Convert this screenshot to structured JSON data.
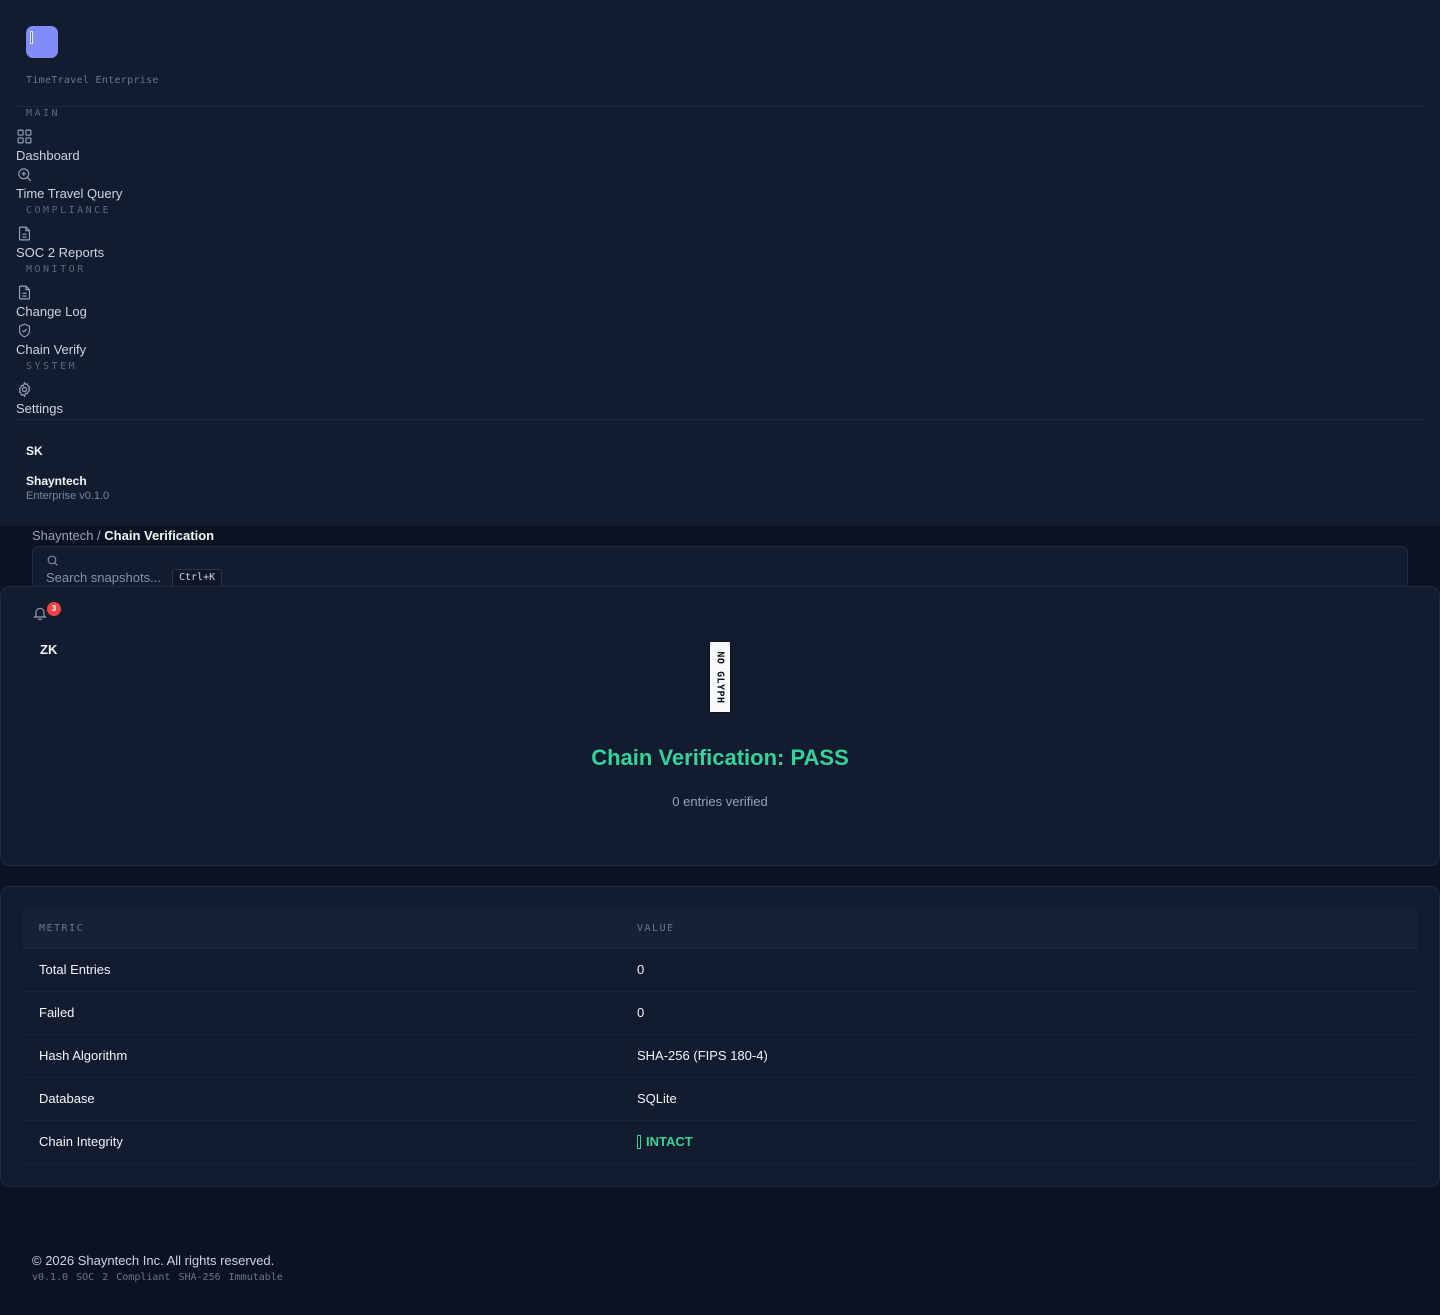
{
  "app": {
    "brand_subtitle": "TimeTravel Enterprise"
  },
  "sidebar": {
    "sections": {
      "main": "MAIN",
      "compliance": "COMPLIANCE",
      "monitor": "MONITOR",
      "system": "SYSTEM"
    },
    "items": [
      {
        "label": "Dashboard",
        "icon": "grid-icon"
      },
      {
        "label": "Time Travel Query",
        "icon": "zoom-in-icon"
      },
      {
        "label": "SOC 2 Reports",
        "icon": "file-icon"
      },
      {
        "label": "Change Log",
        "icon": "file-text-icon"
      },
      {
        "label": "Chain Verify",
        "icon": "shield-check-icon"
      },
      {
        "label": "Settings",
        "icon": "gear-icon"
      }
    ],
    "user": {
      "initials": "SK",
      "name": "Shayntech",
      "role": "Enterprise v0.1.0"
    }
  },
  "header": {
    "breadcrumb_root": "Shayntech",
    "breadcrumb_sep": " / ",
    "breadcrumb_current": "Chain Verification",
    "search_placeholder": "Search snapshots...",
    "search_shortcut": "Ctrl+K",
    "notifications_count": "3",
    "account_initials": "ZK"
  },
  "verification": {
    "image_placeholder": "NO GLYPH",
    "title": "Chain Verification: PASS",
    "subtitle": "0 entries verified"
  },
  "table": {
    "headers": [
      "METRIC",
      "VALUE"
    ],
    "rows": [
      {
        "metric": "Total Entries",
        "value": "0"
      },
      {
        "metric": "Failed",
        "value": "0"
      },
      {
        "metric": "Hash Algorithm",
        "value": "SHA-256 (FIPS 180-4)"
      },
      {
        "metric": "Database",
        "value": "SQLite"
      },
      {
        "metric": "Chain Integrity",
        "value": "INTACT"
      }
    ]
  },
  "footer": {
    "copyright": "© 2026 Shayntech Inc. All rights reserved.",
    "meta": "v0.1.0 SOC 2 Compliant SHA-256 Immutable"
  },
  "colors": {
    "background": "#0b1222",
    "panel": "#131b2e",
    "accent": "#818cf8",
    "success": "#34d399",
    "badge": "#ef4444"
  }
}
